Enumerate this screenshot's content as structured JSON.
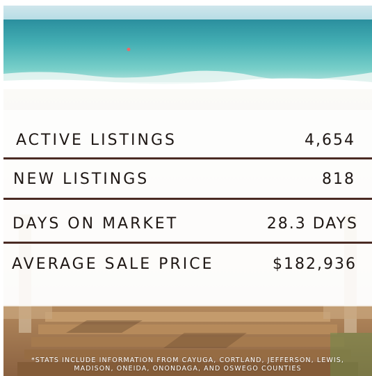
{
  "stats": [
    {
      "label": "ACTIVE LISTINGS",
      "value": "4,654"
    },
    {
      "label": "NEW LISTINGS",
      "value": "818"
    },
    {
      "label": "DAYS ON MARKET",
      "value": "28.3 DAYS"
    },
    {
      "label": "AVERAGE SALE PRICE",
      "value": "$182,936"
    }
  ],
  "footnote": {
    "line1": "*STATS INCLUDE INFORMATION FROM CAYUGA, CORTLAND, JEFFERSON, LEWIS,",
    "line2": "MADISON, ONEIDA, ONONDAGA, AND OSWEGO COUNTIES"
  },
  "colors": {
    "text": "#1e1714",
    "rule": "#4a2a23",
    "sea": "#5fc2c2",
    "sand": "#f3efe9",
    "wood": "#a77a4e"
  }
}
